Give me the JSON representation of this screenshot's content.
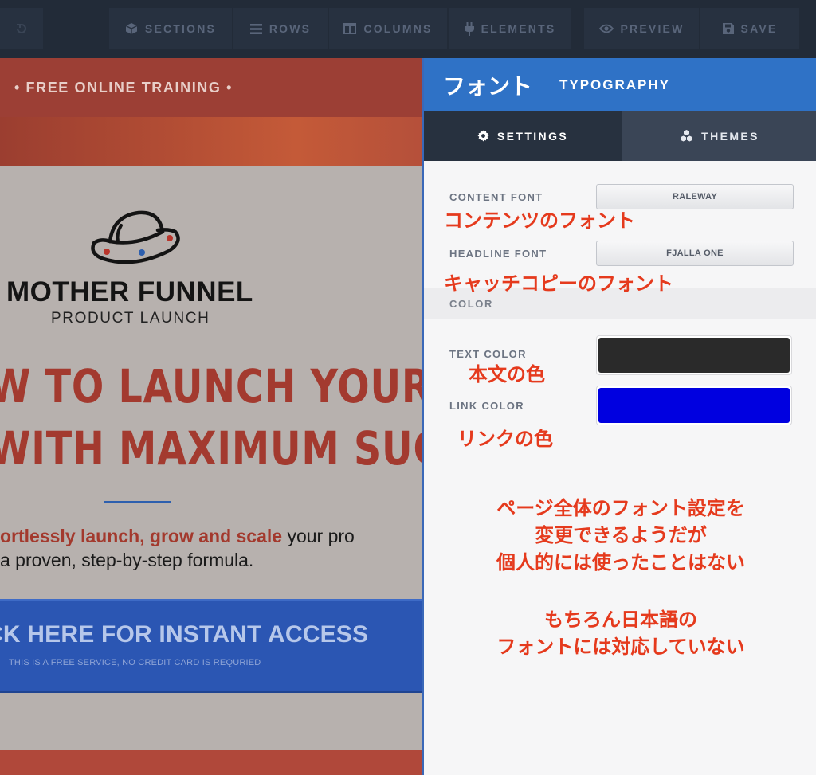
{
  "toolbar": {
    "sections": "SECTIONS",
    "rows": "ROWS",
    "columns": "COLUMNS",
    "elements": "ELEMENTS",
    "preview": "PREVIEW",
    "save": "SAVE"
  },
  "preview": {
    "top_bar": "• FREE ONLINE TRAINING •",
    "brand_title": "MOTHER FUNNEL",
    "brand_subtitle": "PRODUCT LAUNCH",
    "headline_line1": "W TO LAUNCH YOUR NEX",
    "headline_line2": "WITH MAXIMUM SUCCES",
    "subcopy_em": "ortlessly launch, grow and scale",
    "subcopy_rest": " your pro",
    "subcopy_line2": " a proven, step-by-step formula.",
    "cta_main": "CK HERE FOR INSTANT ACCESS",
    "cta_sub": "THIS IS A FREE SERVICE, NO CREDIT CARD IS REQURIED"
  },
  "panel": {
    "title_jp": "フォント",
    "title_en": "TYPOGRAPHY",
    "tab_settings": "SETTINGS",
    "tab_themes": "THEMES",
    "content_font_label": "CONTENT FONT",
    "content_font_value": "RALEWAY",
    "headline_font_label": "HEADLINE FONT",
    "headline_font_value": "FJALLA ONE",
    "color_section": "COLOR",
    "text_color_label": "TEXT COLOR",
    "text_color_value": "#2a2a2a",
    "link_color_label": "LINK COLOR",
    "link_color_value": "#0000e0"
  },
  "annotations": {
    "content_font": "コンテンツのフォント",
    "headline_font": "キャッチコピーのフォント",
    "text_color": "本文の色",
    "link_color": "リンクの色",
    "note1_line1": "ページ全体のフォント設定を",
    "note1_line2": "変更できるようだが",
    "note1_line3": "個人的には使ったことはない",
    "note2_line1": "もちろん日本語の",
    "note2_line2": "フォントには対応していない"
  },
  "colors": {
    "accent_blue": "#2f72c6",
    "annotation_red": "#e53a1d"
  }
}
